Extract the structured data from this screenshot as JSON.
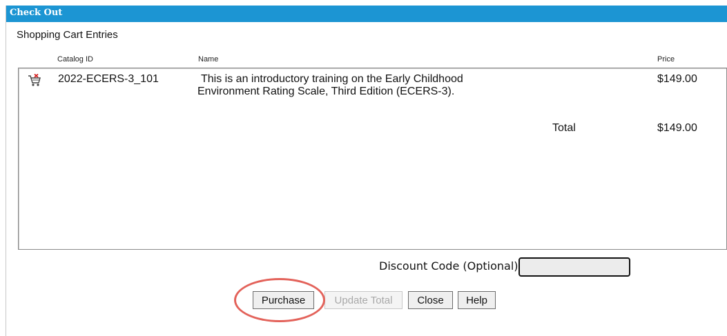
{
  "window": {
    "title": "Check Out"
  },
  "cart": {
    "heading": "Shopping Cart Entries",
    "columns": {
      "catalog_id": "Catalog ID",
      "name": "Name",
      "price": "Price"
    },
    "items": [
      {
        "icon": "cart-remove-icon",
        "catalog_id": "2022-ECERS-3_101",
        "name_line1": "This is an introductory training on the Early Childhood",
        "name_line2": "Environment Rating Scale, Third Edition (ECERS-3).",
        "price": "$149.00"
      }
    ],
    "total_label": "Total",
    "total_value": "$149.00"
  },
  "discount": {
    "label": "Discount Code (Optional)",
    "value": ""
  },
  "buttons": {
    "purchase": "Purchase",
    "update_total": "Update Total",
    "close": "Close",
    "help": "Help"
  },
  "colors": {
    "titlebar": "#1c95d3",
    "highlight": "#e3625a"
  }
}
